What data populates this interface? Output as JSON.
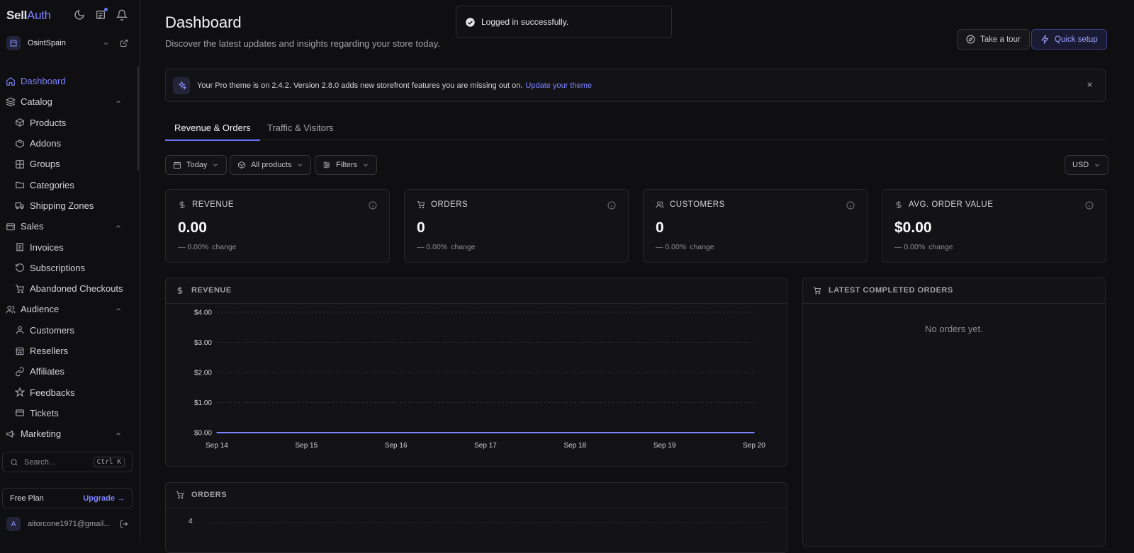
{
  "brand": {
    "part1": "Sell",
    "part2": "Auth"
  },
  "store": {
    "name": "OsintSpain"
  },
  "sidebar": {
    "items": [
      {
        "label": "Dashboard",
        "icon": "home-icon",
        "level": 0,
        "active": true
      },
      {
        "label": "Catalog",
        "icon": "layers-icon",
        "level": 0,
        "section": true
      },
      {
        "label": "Products",
        "icon": "box-icon",
        "level": 1
      },
      {
        "label": "Addons",
        "icon": "package-icon",
        "level": 1
      },
      {
        "label": "Groups",
        "icon": "grid-icon",
        "level": 1
      },
      {
        "label": "Categories",
        "icon": "folder-icon",
        "level": 1
      },
      {
        "label": "Shipping Zones",
        "icon": "truck-icon",
        "level": 1
      },
      {
        "label": "Sales",
        "icon": "wallet-icon",
        "level": 0,
        "section": true
      },
      {
        "label": "Invoices",
        "icon": "receipt-icon",
        "level": 1
      },
      {
        "label": "Subscriptions",
        "icon": "refresh-icon",
        "level": 1
      },
      {
        "label": "Abandoned Checkouts",
        "icon": "cart-icon",
        "level": 1
      },
      {
        "label": "Audience",
        "icon": "users-icon",
        "level": 0,
        "section": true
      },
      {
        "label": "Customers",
        "icon": "user-icon",
        "level": 1
      },
      {
        "label": "Resellers",
        "icon": "store-icon",
        "level": 1
      },
      {
        "label": "Affiliates",
        "icon": "link-icon",
        "level": 1
      },
      {
        "label": "Feedbacks",
        "icon": "star-icon",
        "level": 1
      },
      {
        "label": "Tickets",
        "icon": "ticket-icon",
        "level": 1
      },
      {
        "label": "Marketing",
        "icon": "megaphone-icon",
        "level": 0,
        "section": true
      }
    ]
  },
  "search": {
    "placeholder": "Search...",
    "shortcut": "Ctrl K"
  },
  "plan": {
    "name": "Free Plan",
    "upgrade": "Upgrade →"
  },
  "user": {
    "avatar": "A",
    "email": "aitorcone1971@gmail..."
  },
  "header": {
    "title": "Dashboard",
    "subtitle": "Discover the latest updates and insights regarding your store today.",
    "tour": "Take a tour",
    "setup": "Quick setup"
  },
  "toast": {
    "message": "Logged in successfully."
  },
  "banner": {
    "text": "Your Pro theme is on 2.4.2. Version 2.8.0 adds new storefront features you are missing out on.",
    "link": "Update your theme"
  },
  "tabs": [
    {
      "label": "Revenue & Orders",
      "active": true
    },
    {
      "label": "Traffic & Visitors",
      "active": false
    }
  ],
  "filters": {
    "range": "Today",
    "products": "All products",
    "filters": "Filters",
    "currency": "USD"
  },
  "stats": [
    {
      "title": "REVENUE",
      "icon": "dollar-icon",
      "value": "0.00",
      "change": "0.00%",
      "change_label": "change"
    },
    {
      "title": "ORDERS",
      "icon": "cart-icon",
      "value": "0",
      "change": "0.00%",
      "change_label": "change"
    },
    {
      "title": "CUSTOMERS",
      "icon": "users-icon",
      "value": "0",
      "change": "0.00%",
      "change_label": "change"
    },
    {
      "title": "AVG. ORDER VALUE",
      "icon": "dollar-icon",
      "value": "$0.00",
      "change": "0.00%",
      "change_label": "change"
    }
  ],
  "revenue_panel": {
    "title": "REVENUE"
  },
  "orders_panel": {
    "title": "ORDERS",
    "first_tick": "4"
  },
  "latest_panel": {
    "title": "LATEST COMPLETED ORDERS",
    "empty": "No orders yet."
  },
  "colors": {
    "accent": "#6b74ff",
    "line": "#7c83ff"
  },
  "chart_data": {
    "type": "line",
    "x": [
      "Sep 14",
      "Sep 15",
      "Sep 16",
      "Sep 17",
      "Sep 18",
      "Sep 19",
      "Sep 20"
    ],
    "series": [
      {
        "values": [
          0,
          0,
          0,
          0,
          0,
          0,
          0
        ]
      }
    ],
    "yticks": [
      "$0.00",
      "$1.00",
      "$2.00",
      "$3.00",
      "$4.00"
    ],
    "ylim": [
      0,
      4
    ],
    "grid": true
  }
}
